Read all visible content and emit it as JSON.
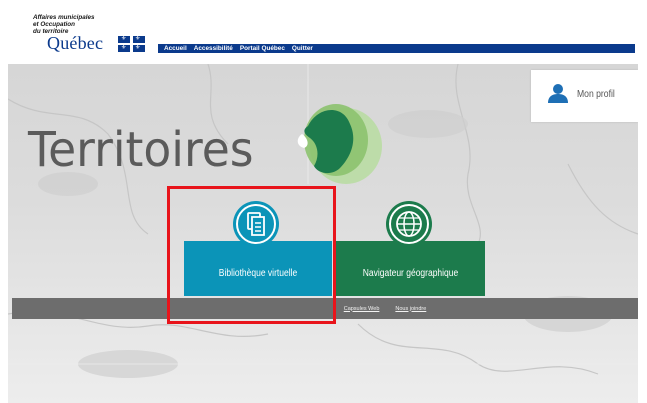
{
  "header": {
    "ministry_lines": [
      "Affaires municipales",
      "et Occupation",
      "du territoire"
    ],
    "brand": "Québec",
    "nav": [
      "Accueil",
      "Accessibilité",
      "Portail Québec",
      "Quitter"
    ]
  },
  "profile": {
    "label": "Mon profil",
    "icon": "user-icon"
  },
  "banner": {
    "title": "Territoires"
  },
  "tiles": [
    {
      "label": "Bibliothèque virtuelle",
      "icon": "document-icon",
      "color": "#0b94b8"
    },
    {
      "label": "Navigateur géographique",
      "icon": "globe-icon",
      "color": "#1c7b4c"
    }
  ],
  "footer": {
    "links": [
      "Capsules Web",
      "Nous joindre"
    ]
  },
  "colors": {
    "brand_blue": "#0b3a8c",
    "highlight": "#e8141b",
    "bar_gray": "#6d6d6d"
  }
}
